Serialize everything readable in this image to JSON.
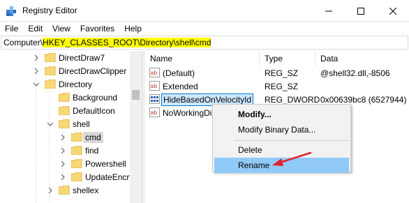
{
  "window": {
    "title": "Registry Editor",
    "controls": {
      "minimize": "minimize-icon",
      "maximize": "maximize-icon",
      "close": "close-icon"
    }
  },
  "menu": [
    "File",
    "Edit",
    "View",
    "Favorites",
    "Help"
  ],
  "address": {
    "prefix": "Computer\\",
    "highlighted": "HKEY_CLASSES_ROOT\\Directory\\shell\\cmd"
  },
  "tree": {
    "items": [
      {
        "label": "DirectDraw7"
      },
      {
        "label": "DirectDrawClipper"
      },
      {
        "label": "Directory"
      },
      {
        "label": "Background"
      },
      {
        "label": "DefaultIcon"
      },
      {
        "label": "shell"
      },
      {
        "label": "cmd"
      },
      {
        "label": "find"
      },
      {
        "label": "Powershell"
      },
      {
        "label": "UpdateEncry"
      },
      {
        "label": "shellex"
      }
    ]
  },
  "values": {
    "columns": [
      "Name",
      "Type",
      "Data"
    ],
    "rows": [
      {
        "name": "(Default)",
        "type": "REG_SZ",
        "data": "@shell32.dll,-8506",
        "icon": "string-value-icon"
      },
      {
        "name": "Extended",
        "type": "REG_SZ",
        "data": "",
        "icon": "string-value-icon"
      },
      {
        "name": "HideBasedOnVelocityId",
        "type": "REG_DWORD",
        "data": "0x00639bc8 (6527944)",
        "icon": "dword-value-icon"
      },
      {
        "name": "NoWorkingDi",
        "type": "",
        "data": "",
        "icon": "string-value-icon"
      }
    ]
  },
  "context_menu": {
    "items": [
      "Modify...",
      "Modify Binary Data...",
      "Delete",
      "Rename"
    ],
    "highlighted": "Rename"
  },
  "colors": {
    "address_highlight": "#ffff00",
    "selection_border": "#0078d7",
    "menu_highlight": "#91c9f7",
    "annotation_arrow": "#e0242b",
    "folder": "#f8d775"
  }
}
